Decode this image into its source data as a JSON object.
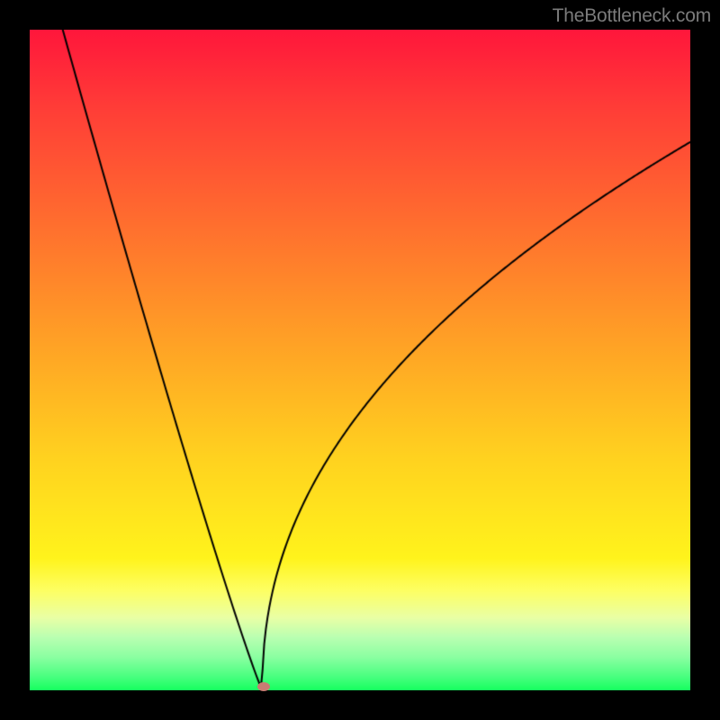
{
  "watermark": "TheBottleneck.com",
  "chart_data": {
    "type": "line",
    "title": "",
    "xlabel": "",
    "ylabel": "",
    "xlim": [
      0,
      1
    ],
    "ylim": [
      0,
      1
    ],
    "x": [
      0.0,
      0.05,
      0.1,
      0.15,
      0.2,
      0.25,
      0.3,
      0.352,
      0.4,
      0.45,
      0.5,
      0.55,
      0.6,
      0.65,
      0.7,
      0.75,
      0.8,
      0.85,
      0.9,
      0.95,
      1.0
    ],
    "values": [
      1.0,
      0.9,
      0.78,
      0.66,
      0.52,
      0.37,
      0.2,
      0.0,
      0.12,
      0.28,
      0.41,
      0.52,
      0.6,
      0.67,
      0.72,
      0.76,
      0.8,
      0.82,
      0.85,
      0.87,
      0.88
    ],
    "marker": {
      "x": 0.354,
      "y": 0.005,
      "color": "#c97c73"
    },
    "background_gradient": [
      "#ff163b",
      "#ff6a2f",
      "#ffd21f",
      "#fff31c",
      "#b9ffb1",
      "#16ff5f"
    ]
  }
}
